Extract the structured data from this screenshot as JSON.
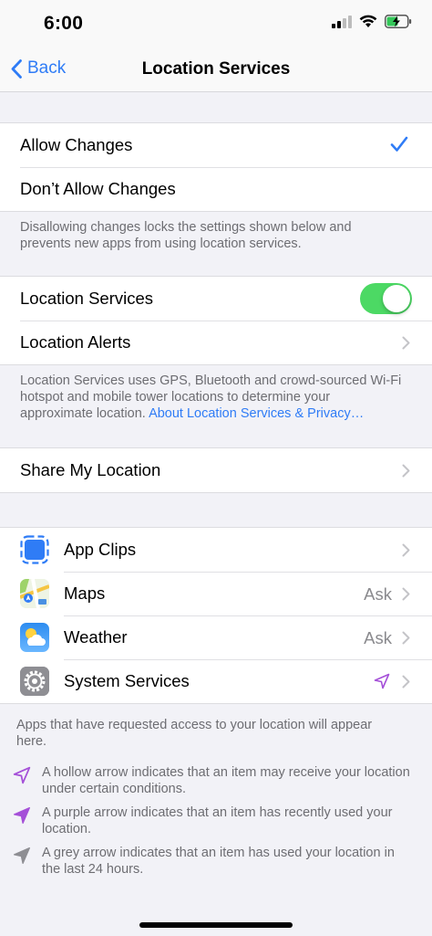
{
  "status": {
    "time": "6:00"
  },
  "nav": {
    "back_label": "Back",
    "title": "Location Services"
  },
  "allow_group": {
    "allow_label": "Allow Changes",
    "dont_allow_label": "Don’t Allow Changes",
    "footnote": "Disallowing changes locks the settings shown below and prevents new apps from using location services."
  },
  "location_group": {
    "services_label": "Location Services",
    "services_on": true,
    "alerts_label": "Location Alerts",
    "footnote": "Location Services uses GPS, Bluetooth and crowd-sourced Wi-Fi hotspot and mobile tower locations to determine your approximate location.",
    "footnote_link": "About Location Services & Privacy…"
  },
  "share": {
    "label": "Share My Location"
  },
  "apps": [
    {
      "label": "App Clips",
      "value": "",
      "icon": "app-clips-icon"
    },
    {
      "label": "Maps",
      "value": "Ask",
      "icon": "maps-icon"
    },
    {
      "label": "Weather",
      "value": "Ask",
      "icon": "weather-icon"
    },
    {
      "label": "System Services",
      "value": "",
      "icon": "gear-icon",
      "status_icon": "hollow-purple-arrow-icon"
    }
  ],
  "apps_footnote": "Apps that have requested access to your location will appear here.",
  "legend": [
    {
      "icon": "hollow-arrow-icon",
      "text": "A hollow arrow indicates that an item may receive your location under certain conditions."
    },
    {
      "icon": "purple-arrow-icon",
      "text": "A purple arrow indicates that an item has recently used your location."
    },
    {
      "icon": "grey-arrow-icon",
      "text": "A grey arrow indicates that an item has used your location in the last 24 hours."
    }
  ],
  "colors": {
    "accent": "#2f7cf6",
    "toggle_on": "#4cd964",
    "purple": "#a550d8",
    "grey": "#8e8e93"
  }
}
